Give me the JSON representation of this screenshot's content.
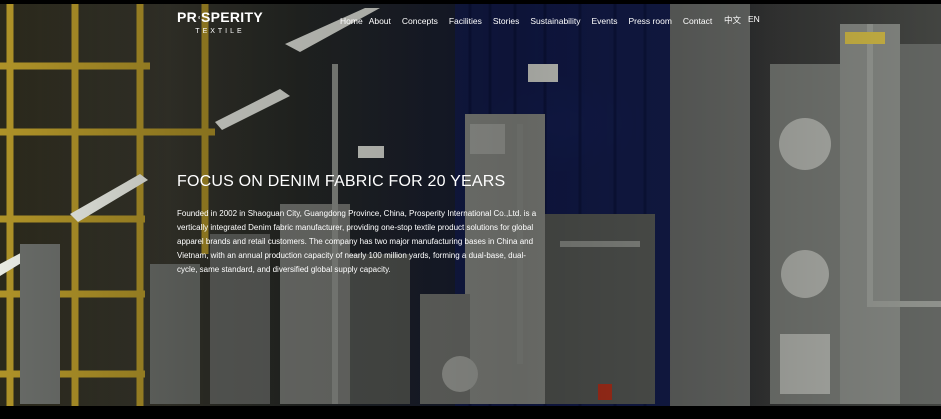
{
  "brand": {
    "name_pre": "PR",
    "name_post": "SPERITY",
    "subline": "TEXTILE"
  },
  "nav": {
    "items": [
      {
        "label": "Home",
        "key": "home"
      },
      {
        "label": "About",
        "key": "about"
      },
      {
        "label": "Concepts",
        "key": "concepts"
      },
      {
        "label": "Facilities",
        "key": "facilities"
      },
      {
        "label": "Stories",
        "key": "stories"
      },
      {
        "label": "Sustainability",
        "key": "sustainability"
      },
      {
        "label": "Events",
        "key": "events"
      },
      {
        "label": "Press room",
        "key": "press-room"
      },
      {
        "label": "Contact",
        "key": "contact"
      }
    ]
  },
  "language": {
    "chinese": "中文",
    "english": "EN"
  },
  "hero": {
    "headline": "FOCUS ON DENIM FABRIC FOR 20 YEARS",
    "description": "Founded in 2002 in Shaoguan City, Guangdong Province, China, Prosperity International Co.,Ltd. is a vertically integrated Denim fabric manufacturer, providing one-stop textile product solutions for global apparel brands and retail customers. The company has two major manufacturing bases in China and Vietnam, with an annual production capacity of nearly 100 million yards, forming a dual-base, dual-cycle, same standard, and diversified global supply capacity."
  },
  "colors": {
    "accent_blue": "#13205a",
    "background": "#0a0a0a"
  }
}
